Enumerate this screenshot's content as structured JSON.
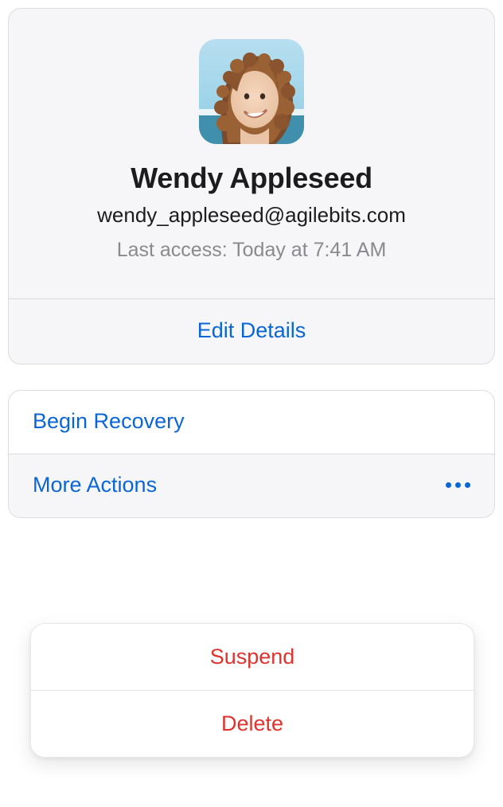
{
  "profile": {
    "name": "Wendy Appleseed",
    "email": "wendy_appleseed@agilebits.com",
    "last_access": "Last access: Today at 7:41 AM",
    "edit_label": "Edit Details"
  },
  "actions": {
    "begin_recovery_label": "Begin Recovery",
    "more_actions_label": "More Actions"
  },
  "popup": {
    "suspend_label": "Suspend",
    "delete_label": "Delete"
  }
}
